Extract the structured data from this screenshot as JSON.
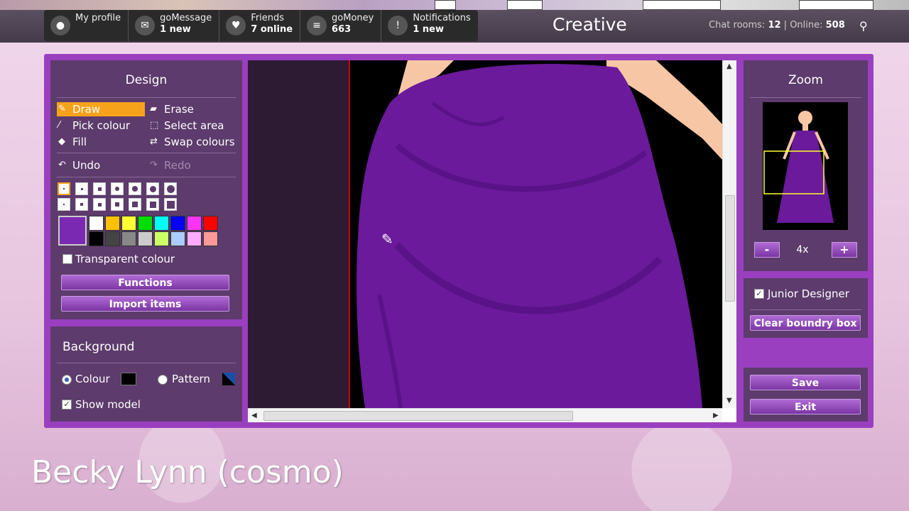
{
  "header": {
    "nav": [
      {
        "label": "My profile",
        "sub": "",
        "icon": "user-icon"
      },
      {
        "label": "goMessage",
        "sub": "1 new",
        "icon": "envelope-icon"
      },
      {
        "label": "Friends",
        "sub": "7 online",
        "icon": "heart-icon"
      },
      {
        "label": "goMoney",
        "sub": "663",
        "icon": "money-icon"
      },
      {
        "label": "Notifications",
        "sub": "1 new",
        "icon": "alert-icon"
      }
    ],
    "title": "Creative",
    "chat_rooms_label": "Chat rooms:",
    "chat_rooms_value": "12",
    "online_label": "Online:",
    "online_value": "508"
  },
  "design": {
    "title": "Design",
    "tools": {
      "draw": "Draw",
      "erase": "Erase",
      "pick_colour": "Pick colour",
      "select_area": "Select area",
      "fill": "Fill",
      "swap_colours": "Swap colours"
    },
    "undo": "Undo",
    "redo": "Redo",
    "palette": [
      "#ffffff",
      "#ffc000",
      "#ffff33",
      "#00dd00",
      "#00ffff",
      "#0000ff",
      "#ff33ff",
      "#ff0000",
      "#000000",
      "#444444",
      "#888888",
      "#cccccc",
      "#ccff66",
      "#aaccff",
      "#ffaaff",
      "#ff9999"
    ],
    "current_colour": "#7a2ab2",
    "transparent_label": "Transparent colour",
    "functions_button": "Functions",
    "import_button": "Import items"
  },
  "background": {
    "title": "Background",
    "colour_label": "Colour",
    "colour_value": "#000000",
    "pattern_label": "Pattern",
    "show_model_label": "Show model",
    "selected": "colour"
  },
  "zoom": {
    "title": "Zoom",
    "level": "4x",
    "minus": "-",
    "plus": "+"
  },
  "junior_designer_label": "Junior Designer",
  "clear_box_button": "Clear boundry box",
  "save_button": "Save",
  "exit_button": "Exit",
  "caption": "Becky Lynn (cosmo)",
  "colors": {
    "accent": "#9a3fc0",
    "panel": "#5d3b6c",
    "active_tool": "#f7a21b",
    "dress": "#6a1a9a"
  }
}
